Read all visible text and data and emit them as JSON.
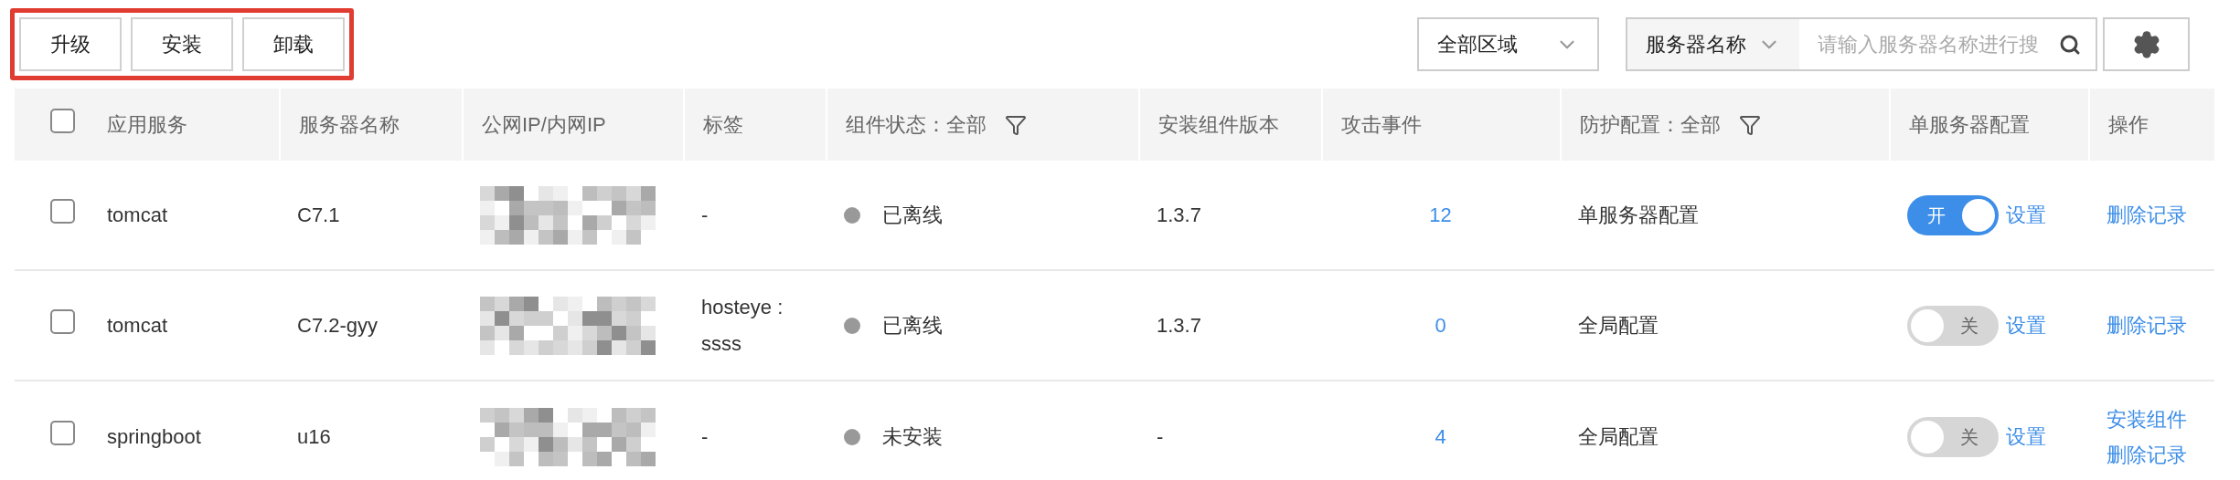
{
  "toolbar": {
    "highlighted": true,
    "buttons": [
      "升级",
      "安装",
      "卸载"
    ]
  },
  "region_select": {
    "value": "全部区域"
  },
  "search": {
    "field": "服务器名称",
    "placeholder": "请输入服务器名称进行搜"
  },
  "table": {
    "select_all": {
      "checked": false
    },
    "columns": [
      {
        "label": "应用服务",
        "kind": "plain"
      },
      {
        "label": "服务器名称",
        "kind": "plain"
      },
      {
        "label": "公网IP/内网IP",
        "kind": "plain"
      },
      {
        "label": "标签",
        "kind": "plain"
      },
      {
        "label": "组件状态：全部",
        "kind": "filter"
      },
      {
        "label": "安装组件版本",
        "kind": "plain"
      },
      {
        "label": "攻击事件",
        "kind": "plain"
      },
      {
        "label": "防护配置：全部",
        "kind": "filter"
      },
      {
        "label": "单服务器配置",
        "kind": "plain"
      },
      {
        "label": "操作",
        "kind": "plain"
      }
    ],
    "rows": [
      {
        "checked": false,
        "app": "tomcat",
        "server": "C7.1",
        "tag": "-",
        "status": "已离线",
        "version": "1.3.7",
        "attacks": "12",
        "protection": "单服务器配置",
        "switch": {
          "on": true,
          "label": "开"
        },
        "settings": "设置",
        "actions": [
          "删除记录"
        ]
      },
      {
        "checked": false,
        "app": "tomcat",
        "server": "C7.2-gyy",
        "tag": "hosteye : ssss",
        "status": "已离线",
        "version": "1.3.7",
        "attacks": "0",
        "protection": "全局配置",
        "switch": {
          "on": false,
          "label": "关"
        },
        "settings": "设置",
        "actions": [
          "删除记录"
        ]
      },
      {
        "checked": false,
        "app": "springboot",
        "server": "u16",
        "tag": "-",
        "status": "未安装",
        "version": "-",
        "attacks": "4",
        "protection": "全局配置",
        "switch": {
          "on": false,
          "label": "关"
        },
        "settings": "设置",
        "actions": [
          "安装组件",
          "删除记录"
        ]
      }
    ]
  }
}
